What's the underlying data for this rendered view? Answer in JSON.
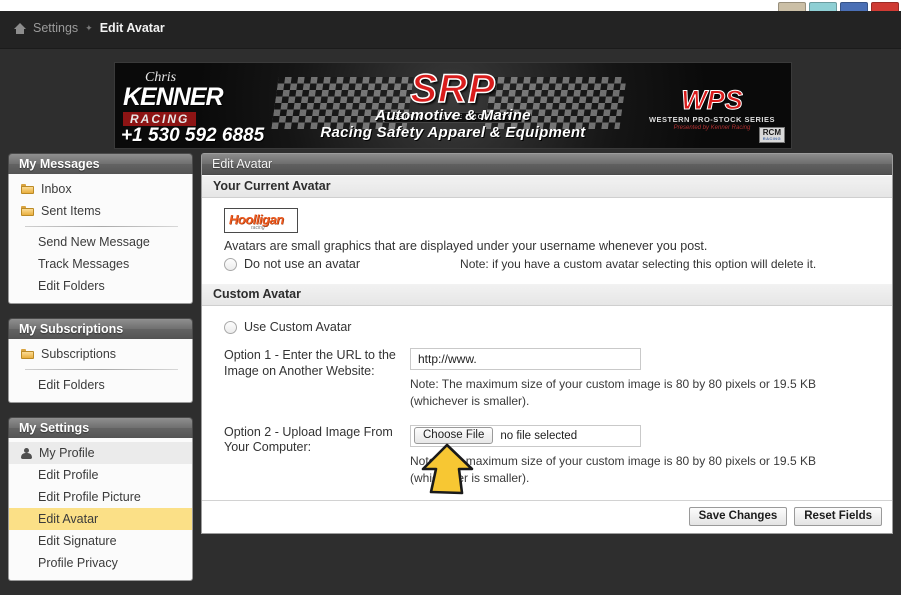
{
  "browser": {
    "tab_colors": [
      "#cbbfa6",
      "#8ecfd4",
      "#4a6fb5",
      "#cf3a33"
    ]
  },
  "breadcrumb": {
    "home_icon": "home-icon",
    "settings": "Settings",
    "separator": "✦",
    "current": "Edit Avatar"
  },
  "banner": {
    "kenner_script": "Chris",
    "kenner_name": "KENNER",
    "kenner_racing": "RACING",
    "phone": "+1 530 592 6885",
    "srp": "SRP",
    "srp_sub": "SECURITY RACE PRODUCTS",
    "tagline_line1": "Automotive & Marine",
    "tagline_line2": "Racing Safety Apparel & Equipment",
    "wps": "WPS",
    "wps_sub1": "WESTERN PRO-STOCK SERIES",
    "wps_sub2": "Presented by Kenner Racing",
    "rcm": "RCM",
    "rcm_sub": "RACING"
  },
  "sidebar": {
    "blocks": [
      {
        "title": "My Messages",
        "items": [
          {
            "label": "Inbox",
            "icon": "folder-icon",
            "indented": false,
            "active": false
          },
          {
            "label": "Sent Items",
            "icon": "folder-icon",
            "indented": false,
            "active": false
          },
          {
            "divider": true
          },
          {
            "label": "Send New Message",
            "icon": "",
            "indented": true,
            "active": false
          },
          {
            "label": "Track Messages",
            "icon": "",
            "indented": true,
            "active": false
          },
          {
            "label": "Edit Folders",
            "icon": "",
            "indented": true,
            "active": false
          }
        ]
      },
      {
        "title": "My Subscriptions",
        "items": [
          {
            "label": "Subscriptions",
            "icon": "folder-icon",
            "indented": false,
            "active": false
          },
          {
            "divider": true
          },
          {
            "label": "Edit Folders",
            "icon": "",
            "indented": true,
            "active": false
          }
        ]
      },
      {
        "title": "My Settings",
        "items": [
          {
            "label": "My Profile",
            "icon": "person-icon",
            "indented": false,
            "active": false,
            "shaded": true
          },
          {
            "label": "Edit Profile",
            "icon": "",
            "indented": true,
            "active": false
          },
          {
            "label": "Edit Profile Picture",
            "icon": "",
            "indented": true,
            "active": false
          },
          {
            "label": "Edit Avatar",
            "icon": "",
            "indented": true,
            "active": true
          },
          {
            "label": "Edit Signature",
            "icon": "",
            "indented": true,
            "active": false
          },
          {
            "label": "Profile Privacy",
            "icon": "",
            "indented": true,
            "active": false
          }
        ]
      }
    ]
  },
  "panel": {
    "title": "Edit Avatar",
    "current_avatar": {
      "section_title": "Your Current Avatar",
      "thumb_word": "Hoolligan",
      "thumb_sub": "racing",
      "description": "Avatars are small graphics that are displayed under your username whenever you post.",
      "radio_label": "Do not use an avatar",
      "radio_note": "Note: if you have a custom avatar selecting this option will delete it."
    },
    "custom_avatar": {
      "section_title": "Custom Avatar",
      "radio_label": "Use Custom Avatar",
      "option1_label": "Option 1 - Enter the URL to the Image on Another Website:",
      "option1_value": "http://www.",
      "option1_note": "Note: The maximum size of your custom image is 80 by 80 pixels or 19.5 KB (whichever is smaller).",
      "option2_label": "Option 2 - Upload Image From Your Computer:",
      "option2_button": "Choose File",
      "option2_filename": "no file selected",
      "option2_note": "Note: The maximum size of your custom image is 80 by 80 pixels or 19.5 KB (whichever is smaller)."
    },
    "footer": {
      "save": "Save Changes",
      "reset": "Reset Fields"
    }
  },
  "annotation": {
    "arrow": "up-arrow-annotation",
    "arrow_color": "#f7c733"
  }
}
